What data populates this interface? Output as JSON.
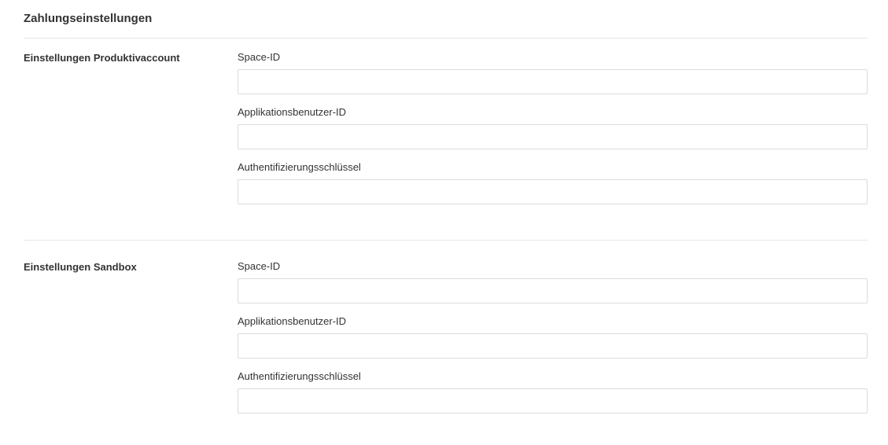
{
  "page": {
    "title": "Zahlungseinstellungen"
  },
  "sections": [
    {
      "title": "Einstellungen Produktivaccount",
      "fields": [
        {
          "label": "Space-ID",
          "value": "",
          "placeholder": ""
        },
        {
          "label": "Applikationsbenutzer-ID",
          "value": "",
          "placeholder": ""
        },
        {
          "label": "Authentifizierungsschlüssel",
          "value": "",
          "placeholder": ""
        }
      ]
    },
    {
      "title": "Einstellungen Sandbox",
      "fields": [
        {
          "label": "Space-ID",
          "value": "",
          "placeholder": ""
        },
        {
          "label": "Applikationsbenutzer-ID",
          "value": "",
          "placeholder": ""
        },
        {
          "label": "Authentifizierungsschlüssel",
          "value": "",
          "placeholder": ""
        }
      ]
    }
  ]
}
